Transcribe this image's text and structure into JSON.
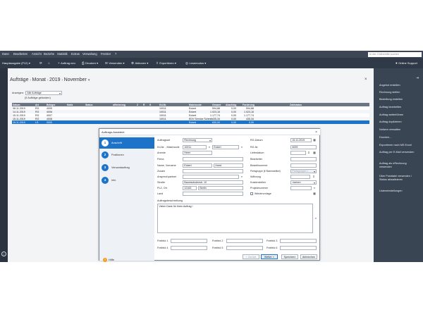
{
  "menubar": {
    "items": [
      "Datei",
      "Bearbeiten",
      "Ansicht",
      "Beziehe",
      "Statistik",
      "Extras",
      "Verwaltung",
      "Fenster",
      "?"
    ],
    "search_placeholder": "In der Onlinehilfe suchen"
  },
  "toolbar": {
    "context": "Hauptausgabe (F12)",
    "new_order": "Auftrag neu",
    "print": "Drucken",
    "send": "Versenden",
    "actions": "Aktionen",
    "export": "Exportieren",
    "reference_mode": "Lesemodus",
    "online_support": "Online Support"
  },
  "header": {
    "title": "Aufträge",
    "period": "Monat",
    "year": "2019",
    "month": "November",
    "close_glyph": "×"
  },
  "filter": {
    "label": "Anzeigen:",
    "value": "Alle Aufträge",
    "count": "(5 Aufträge gefunden)"
  },
  "table": {
    "columns": [
      "Datum",
      "Art",
      "Belegnr",
      "Notiz",
      "Status",
      "offerierung",
      "Z",
      "R",
      "S",
      "Kd-Nr.",
      "Matchcode",
      "Gesamt",
      "Abschlag",
      "Forderung",
      "Zahlstatus"
    ],
    "rows": [
      [
        "08.11.2019",
        "RG",
        "4005",
        "",
        "",
        "",
        "",
        "",
        "",
        "10011",
        "Eckert",
        "594,88",
        "0,00",
        "594,88",
        ""
      ],
      [
        "14.11.2019",
        "RG",
        "4006",
        "",
        "",
        "",
        "",
        "",
        "",
        "10011",
        "Eckert",
        "1.023,16",
        "0,00",
        "1.023,16",
        ""
      ],
      [
        "15.11.2019",
        "RG",
        "4007",
        "",
        "",
        "",
        "",
        "",
        "",
        "10011",
        "Eckert",
        "1.177,74",
        "0,00",
        "1.177,74",
        ""
      ],
      [
        "15.11.2019",
        "RG",
        "4008",
        "",
        "",
        "",
        "",
        "",
        "",
        "10011",
        "EDV Service Schmitt",
        "435,34",
        "0,00",
        "435,34",
        ""
      ],
      [
        "15.11.2019",
        "LS",
        "0000",
        "",
        "",
        "",
        "",
        "",
        "",
        "",
        "Eckert",
        "630,00",
        "0,00",
        "0,00",
        ""
      ]
    ],
    "selected_row": 4
  },
  "right_panel": {
    "items": [
      "Angebot erstellen",
      "Rechnung stellen",
      "Bestellung erstellen",
      "Auftrag bearbeiten",
      "Auftrag weiterführen",
      "Auftrag duplizieren",
      "Notizen verwalten",
      "Drucken...",
      "Exportieren nach MS Excel",
      "Auftrag per E-Mail versenden",
      "Auftrag als eRechnung versenden",
      "Über Postdatei versenden / Status aktualisieren",
      "Listeneinstellungen"
    ]
  },
  "dialog": {
    "title": "Auftrags-Assistent",
    "close_glyph": "×",
    "steps": [
      {
        "num": "1",
        "label": "Anschrift"
      },
      {
        "num": "2",
        "label": "Positionen"
      },
      {
        "num": "3",
        "label": "Versandauftrag"
      },
      {
        "num": "4",
        "label": "Info"
      }
    ],
    "active_step": 0,
    "help_label": "Hilfe",
    "left_fields": {
      "auftragsart_label": "Auftragsart",
      "auftragsart_value": "Rechnung",
      "kdnr_label": "Kd-Nr. , Matchcode",
      "kdnr_value": "10011",
      "matchcode_value": "Eckert",
      "anrede_label": "Anrede",
      "anrede_value": "Herrn",
      "firma_label": "Firma",
      "firma_value": "",
      "name_label": "Name,  Vorname",
      "name_value": "Eckert",
      "vorname_value": "Horst",
      "zusatz_label": "Zusatz",
      "zusatz_value": "",
      "ansprech_label": "Ansprechpartner",
      "ansprech_value": "",
      "strasse_label": "Straße",
      "strasse_value": "Baumschulenstr. 10",
      "plz_label": "PLZ,   Ort",
      "plz_value": "12163",
      "ort_value": "Berlin",
      "land_label": "Land",
      "land_value": ""
    },
    "right_fields": {
      "rgdatum_label": "RG-Datum",
      "rgdatum_value": "15.11.2019",
      "rgnr_label": "RG-Nr.",
      "rgnr_value": "4009",
      "lieferdatum_label": "Lieferdatum",
      "lieferdatum_value": "",
      "bearbeiter_label": "Bearbeiter",
      "bearbeiter_value": "",
      "bestellnummer_label": "Bestellnummer",
      "bestellnummer_value": "",
      "preisgruppe_label": "Preisgruppe (lt Stammartikel)",
      "preisgruppe_value": "Preisgruppe 1",
      "waehrung_label": "Währung",
      "waehrung_value": "",
      "kostenstelle_label": "Kostenstellen",
      "kostenstelle_value": "<keine>",
      "projekt_label": "Projektnummer",
      "projekt_value": "",
      "wiedervorlage_label": "Wiedervorlage"
    },
    "description": {
      "label": "Auftragsbeschreibung",
      "value": "Vielen Dank für Ihren Auftrag !"
    },
    "freefields": {
      "f1_label": "Freifeld 1",
      "f2_label": "Freifeld 2",
      "f3_label": "Freifeld 3",
      "f4_label": "Freifeld 4",
      "f5_label": "Freifeld 5",
      "f6_label": "Freifeld 6"
    },
    "buttons": {
      "back": "< Zurück",
      "next": "Weiter >",
      "save": "Speichern",
      "cancel": "Abbrechen"
    }
  }
}
